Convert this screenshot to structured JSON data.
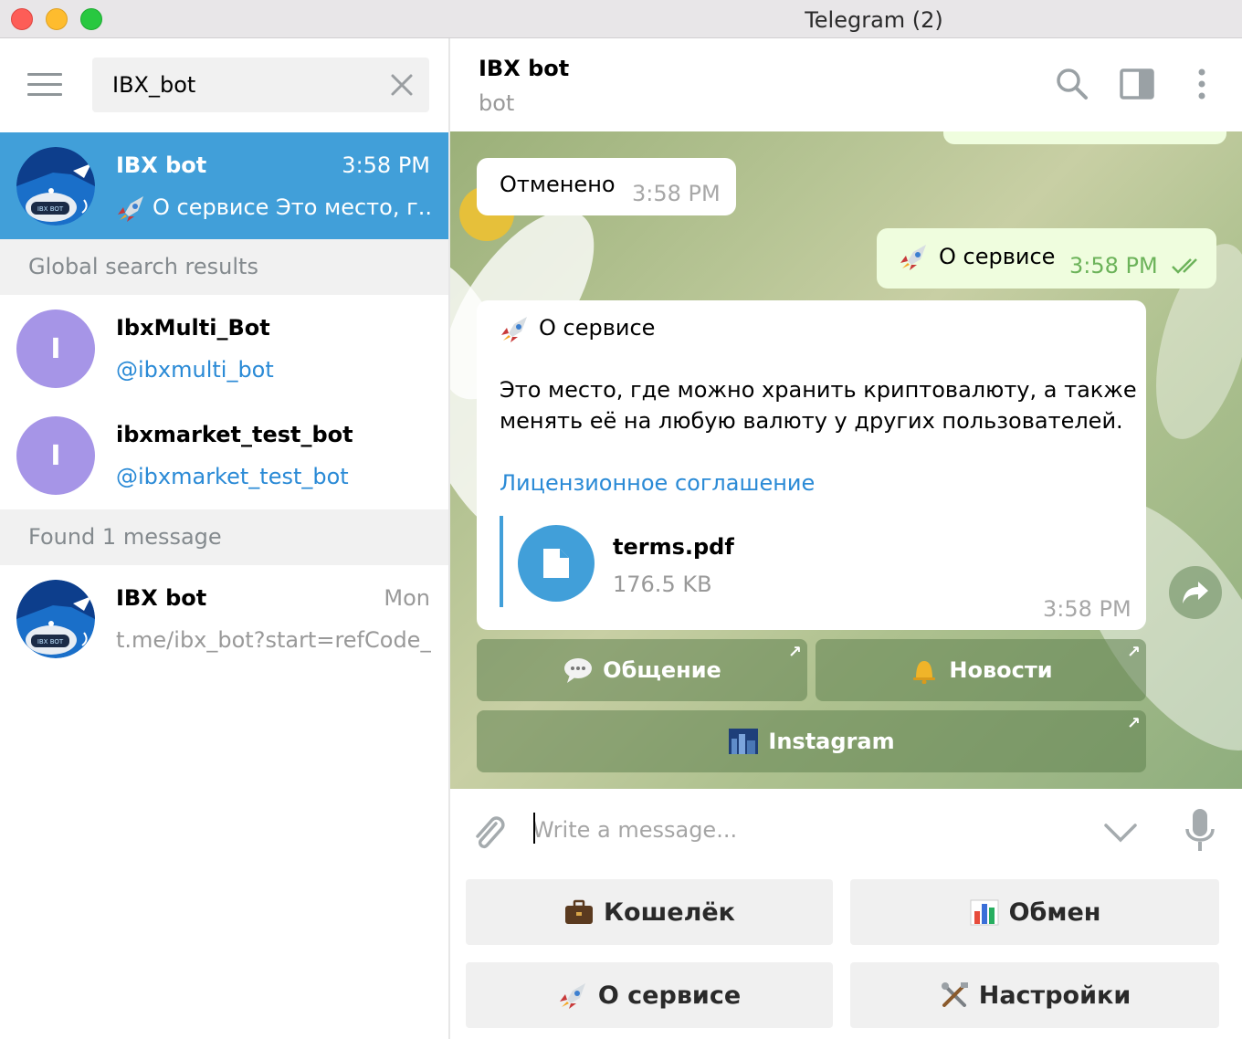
{
  "window": {
    "title": "Telegram (2)"
  },
  "search": {
    "value": "IBX_bot"
  },
  "chats": {
    "active": {
      "name": "IBX bot",
      "time": "3:58 PM",
      "preview": "О сервисе  Это место, г..."
    },
    "global_header": "Global search results",
    "global": [
      {
        "initial": "I",
        "name": "IbxMulti_Bot",
        "username": "@ibxmulti_bot"
      },
      {
        "initial": "I",
        "name": "ibxmarket_test_bot",
        "username": "@ibxmarket_test_bot"
      }
    ],
    "found_header": "Found 1 message",
    "found": {
      "name": "IBX bot",
      "time": "Mon",
      "preview": "t.me/ibx_bot?start=refCode_..."
    }
  },
  "chat_header": {
    "title": "IBX bot",
    "status": "bot"
  },
  "messages": {
    "cancelled": {
      "text": "Отменено",
      "time": "3:58 PM"
    },
    "outgoing": {
      "text": "О сервисе",
      "time": "3:58 PM"
    },
    "about": {
      "title": "О сервисе",
      "line1": "Это место, где можно хранить криптовалюту, а также",
      "line2": "менять её на любую валюту у других пользователей.",
      "link": "Лицензионное соглашение",
      "file_name": "terms.pdf",
      "file_size": "176.5 KB",
      "time": "3:58 PM"
    }
  },
  "inline_buttons": {
    "chat": "Общение",
    "news": "Новости",
    "instagram": "Instagram"
  },
  "compose": {
    "placeholder": "Write a message..."
  },
  "keyboard": {
    "wallet": "Кошелёк",
    "exchange": "Обмен",
    "about": "О сервисе",
    "settings": "Настройки"
  },
  "colors": {
    "accent": "#419fd9",
    "link": "#2a8ad6",
    "outgoing_bubble": "#effdde",
    "avatar_letter_bg": "#a695e7"
  }
}
